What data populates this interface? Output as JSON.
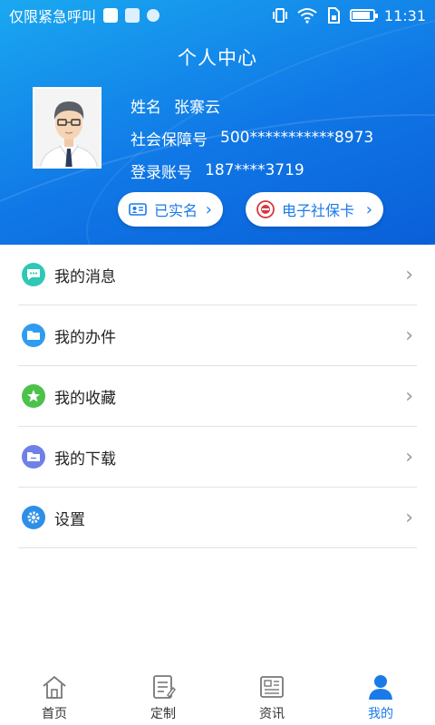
{
  "status_bar": {
    "carrier_text": "仅限紧急呼叫",
    "time": "11:31"
  },
  "header": {
    "title": "个人中心"
  },
  "profile": {
    "name_label": "姓名",
    "name_value": "张寨云",
    "ssn_label": "社会保障号",
    "ssn_value": "500***********8973",
    "account_label": "登录账号",
    "account_value": "187****3719"
  },
  "badges": {
    "verified_label": "已实名",
    "card_label": "电子社保卡"
  },
  "menu": {
    "items": [
      {
        "label": "我的消息",
        "icon": "message-icon",
        "color": "#2fc7b5"
      },
      {
        "label": "我的办件",
        "icon": "folder-icon",
        "color": "#2e9cf0"
      },
      {
        "label": "我的收藏",
        "icon": "star-icon",
        "color": "#4cc24a"
      },
      {
        "label": "我的下载",
        "icon": "download-folder-icon",
        "color": "#6f80e8"
      },
      {
        "label": "设置",
        "icon": "gear-icon",
        "color": "#2e8fe8"
      }
    ]
  },
  "tabbar": {
    "tabs": [
      {
        "label": "首页",
        "icon": "home-icon"
      },
      {
        "label": "定制",
        "icon": "customize-icon"
      },
      {
        "label": "资讯",
        "icon": "news-icon"
      },
      {
        "label": "我的",
        "icon": "profile-icon"
      }
    ],
    "active_color": "#1a7ae8"
  }
}
